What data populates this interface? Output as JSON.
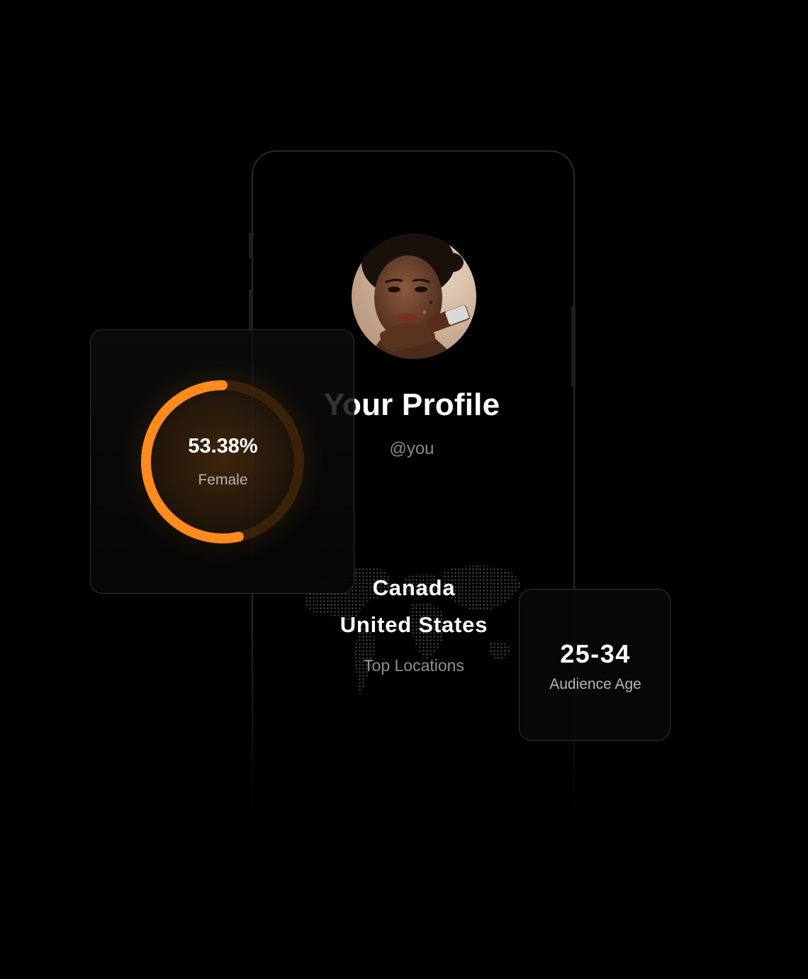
{
  "profile": {
    "title": "Your Profile",
    "handle": "@you"
  },
  "gender": {
    "value": "53.38%",
    "label": "Female",
    "fraction": 0.5338,
    "accent_color": "#FF8A1E",
    "track_color": "#3A2208"
  },
  "locations": {
    "items": [
      "Canada",
      "United States"
    ],
    "label": "Top Locations"
  },
  "age": {
    "value": "25-34",
    "label": "Audience Age"
  },
  "icons": {
    "avatar": "profile-photo-woman",
    "map": "dotted-world-map"
  }
}
